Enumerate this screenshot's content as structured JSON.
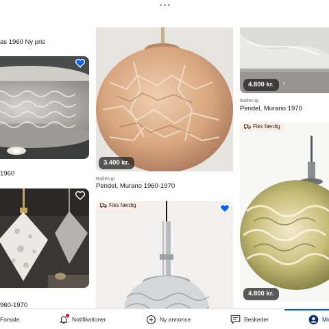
{
  "colors": {
    "accent": "#0063fb",
    "notification_badge": "#e0003c",
    "fix_badge_bg": "#fdeee6",
    "price_bg": "#1c1c1cb8"
  },
  "feed": {
    "col1": {
      "card_top": {
        "title": "as 1960 Ny pris"
      },
      "card_mid": {
        "title": "1960",
        "favorited": true
      },
      "card_bottom": {
        "title": "960-1970",
        "favorited": false
      }
    },
    "col2": {
      "card_top": {
        "price": "3.400 kr.",
        "location": "Ballerup",
        "title": "Pendel, Murano 1960-1970"
      },
      "card_bottom": {
        "badge": "Fiks færdig",
        "favorited": true
      }
    },
    "col3": {
      "card_top": {
        "price": "4.800 kr.",
        "location": "Ballerup",
        "title": "Pendel, Murano 1970"
      },
      "card_bottom": {
        "badge": "Fiks færdig",
        "price": "4.800 kr."
      }
    }
  },
  "tabbar": {
    "tabs": [
      {
        "label": "Forside",
        "icon": "home-icon"
      },
      {
        "label": "Notifikationer",
        "icon": "bell-icon",
        "has_badge": true
      },
      {
        "label": "Ny annonce",
        "icon": "plus-circle-icon"
      },
      {
        "label": "Beskeder",
        "icon": "chat-icon"
      },
      {
        "label": "Min",
        "icon": "profile-icon",
        "active": true
      }
    ]
  }
}
